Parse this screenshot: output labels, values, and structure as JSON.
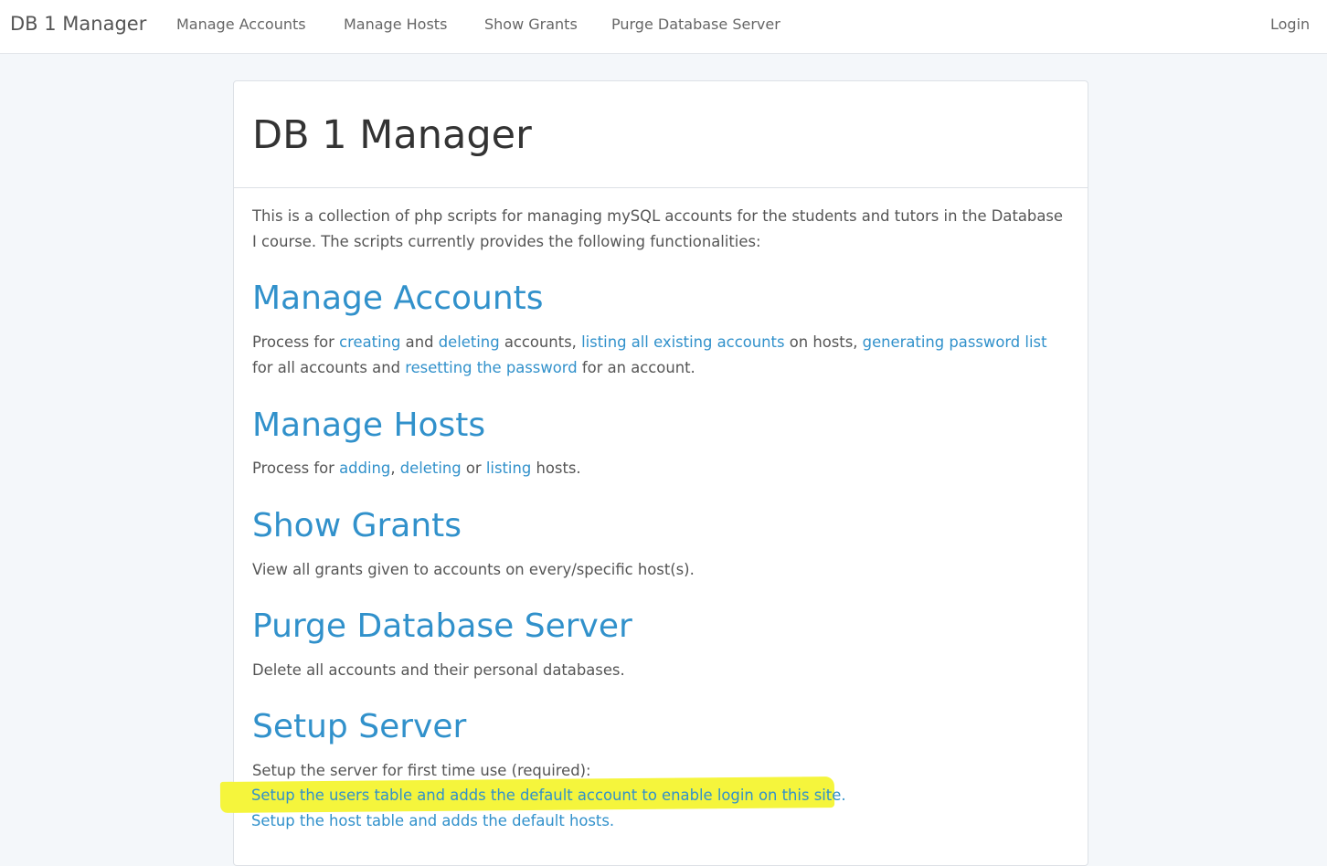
{
  "navbar": {
    "brand": "DB 1 Manager",
    "items": [
      {
        "label": "Manage Accounts"
      },
      {
        "label": "Manage Hosts"
      },
      {
        "label": "Show Grants"
      },
      {
        "label": "Purge Database Server"
      }
    ],
    "login": "Login"
  },
  "panel": {
    "title": "DB 1 Manager",
    "intro": "This is a collection of php scripts for managing mySQL accounts for the students and tutors in the Database I course. The scripts currently provides the following functionalities:",
    "accounts": {
      "title": "Manage Accounts",
      "t1": "Process for ",
      "l_creating": "creating",
      "t2": " and ",
      "l_deleting": "deleting",
      "t3": " accounts, ",
      "l_listing": "listing all existing accounts",
      "t4": " on hosts, ",
      "l_generating": "generating password list",
      "t5": " for all accounts and ",
      "l_resetting": "resetting the password",
      "t6": " for an account."
    },
    "hosts": {
      "title": "Manage Hosts",
      "t1": "Process for ",
      "l_adding": "adding",
      "t2": ", ",
      "l_deleting": "deleting",
      "t3": " or ",
      "l_listing": "listing",
      "t4": " hosts."
    },
    "grants": {
      "title": "Show Grants",
      "text": "View all grants given to accounts on every/specific host(s)."
    },
    "purge": {
      "title": "Purge Database Server",
      "text": "Delete all accounts and their personal databases."
    },
    "setup": {
      "title": "Setup Server",
      "text": "Setup the server for first time use (required):",
      "link_users": "Setup the users table and adds the default account to enable login on this site.",
      "link_hosts": "Setup the host table and adds the default hosts."
    }
  },
  "colors": {
    "link": "#3191cb",
    "highlight": "#f5f53c",
    "background": "#f4f7fa"
  }
}
